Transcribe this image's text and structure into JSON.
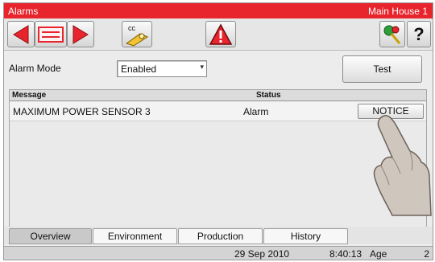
{
  "titlebar": {
    "title": "Alarms",
    "location": "Main House 1"
  },
  "toolbar": {
    "buttons": [
      {
        "icon": "arrow-left-icon"
      },
      {
        "icon": "alarm-list-icon"
      },
      {
        "icon": "arrow-right-icon"
      },
      {
        "icon": "cc-key-icon",
        "label": "cc"
      },
      {
        "icon": "warning-icon"
      },
      {
        "icon": "login-key-icon"
      },
      {
        "icon": "help-icon",
        "label": "?"
      }
    ]
  },
  "settings": {
    "alarm_mode_label": "Alarm Mode",
    "alarm_mode_value": "Enabled",
    "test_button": "Test"
  },
  "table": {
    "columns": [
      "Message",
      "Status"
    ],
    "rows": [
      {
        "message": "MAXIMUM POWER SENSOR  3",
        "status": "Alarm",
        "action": "NOTICE"
      }
    ]
  },
  "tabs": [
    {
      "label": "Overview",
      "active": true
    },
    {
      "label": "Environment",
      "active": false
    },
    {
      "label": "Production",
      "active": false
    },
    {
      "label": "History",
      "active": false
    }
  ],
  "statusbar": {
    "date": "29 Sep 2010",
    "time": "8:40:13",
    "age_label": "Age",
    "age_value": "2"
  },
  "colors": {
    "titlebar": "#e8242c",
    "arrows": "#e8242c",
    "warning": "#e8242c"
  }
}
